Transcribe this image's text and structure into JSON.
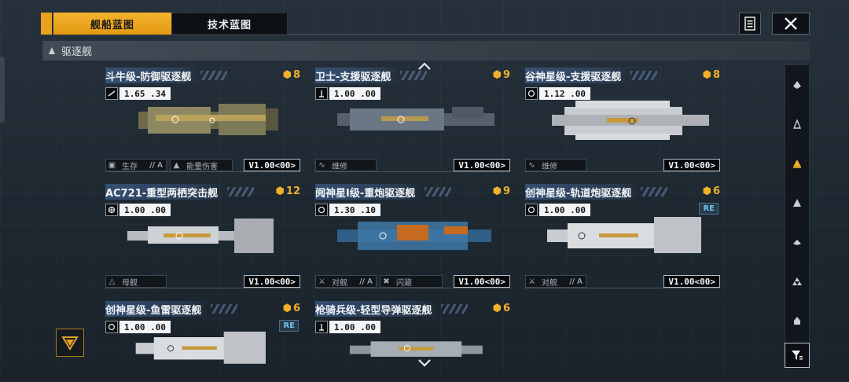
{
  "tabs": {
    "active": "舰船蓝图",
    "inactive": "技术蓝图"
  },
  "section": {
    "title": "驱逐舰"
  },
  "ships": [
    {
      "name": "斗牛级-防御驱逐舰",
      "cost": "8",
      "speed": "1.65 .34",
      "tags": [
        {
          "label": "生存",
          "grade": "// A"
        },
        {
          "label": "能量伤害",
          "grade": ""
        }
      ],
      "version": "V1.00<00>",
      "re": ""
    },
    {
      "name": "卫士-支援驱逐舰",
      "cost": "9",
      "speed": "1.00 .00",
      "tags": [
        {
          "label": "维修",
          "grade": ""
        }
      ],
      "version": "V1.00<00>",
      "re": ""
    },
    {
      "name": "谷神星级-支援驱逐舰",
      "cost": "8",
      "speed": "1.12 .00",
      "tags": [
        {
          "label": "维修",
          "grade": ""
        }
      ],
      "version": "V1.00<00>",
      "re": ""
    },
    {
      "name": "AC721-重型两栖突击舰",
      "cost": "12",
      "speed": "1.00 .00",
      "tags": [
        {
          "label": "母舰",
          "grade": ""
        }
      ],
      "version": "V1.00<00>",
      "re": ""
    },
    {
      "name": "阋神星I级-重炮驱逐舰",
      "cost": "9",
      "speed": "1.30 .10",
      "tags": [
        {
          "label": "对舰",
          "grade": "// A"
        },
        {
          "label": "闪避",
          "grade": ""
        }
      ],
      "version": "V1.00<00>",
      "re": ""
    },
    {
      "name": "创神星级-轨道炮驱逐舰",
      "cost": "6",
      "speed": "1.00 .00",
      "tags": [
        {
          "label": "对舰",
          "grade": "// A"
        }
      ],
      "version": "V1.00<00>",
      "re": "RE"
    },
    {
      "name": "创神星级-鱼雷驱逐舰",
      "cost": "6",
      "speed": "1.00 .00",
      "tags": [],
      "version": "",
      "re": "RE"
    },
    {
      "name": "枪骑兵级-轻型导弹驱逐舰",
      "cost": "6",
      "speed": "1.00 .00",
      "tags": [],
      "version": "",
      "re": ""
    }
  ],
  "colors": {
    "accent": "#f1b12a",
    "panel": "#10161b",
    "title_band": "#466eaa"
  },
  "icons": [
    "list-icon",
    "close-icon",
    "destroyer-class-icon",
    "cost-icon",
    "speed-icon",
    "filter-icon",
    "scroll-up-icon",
    "scroll-down-icon"
  ]
}
